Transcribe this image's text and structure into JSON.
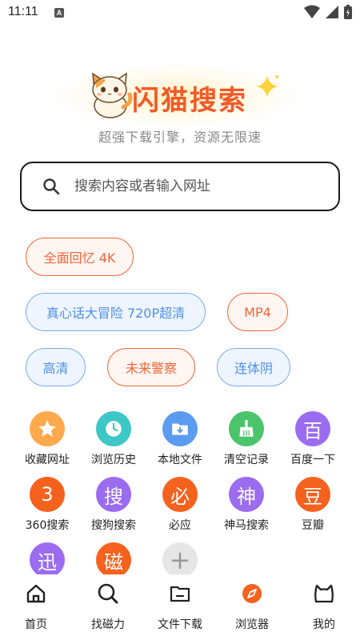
{
  "status": {
    "time": "11:11",
    "notif_letter": "A"
  },
  "hero": {
    "brand": "闪猫搜索",
    "slogan": "超强下载引擎，资源无限速"
  },
  "search": {
    "placeholder": "搜索内容或者输入网址"
  },
  "tags": [
    {
      "label": "全面回忆 4K",
      "style": "orange"
    },
    {
      "label": "真心话大冒险 720P超清",
      "style": "blue"
    },
    {
      "label": "MP4",
      "style": "orange"
    },
    {
      "label": "高清",
      "style": "blue"
    },
    {
      "label": "未来警察",
      "style": "orange"
    },
    {
      "label": "连体阴",
      "style": "blue"
    }
  ],
  "shortcuts": [
    {
      "label": "收藏网址",
      "icon": "star-icon",
      "glyph": "★",
      "color": "#ffa94d"
    },
    {
      "label": "浏览历史",
      "icon": "clock-icon",
      "glyph": "",
      "color": "#3dc7c6"
    },
    {
      "label": "本地文件",
      "icon": "folder-download-icon",
      "glyph": "",
      "color": "#5b9cf0"
    },
    {
      "label": "清空记录",
      "icon": "broom-icon",
      "glyph": "",
      "color": "#4cc46b"
    },
    {
      "label": "百度一下",
      "icon": "baidu-icon",
      "glyph": "百",
      "color": "#9b6cf0"
    },
    {
      "label": "360搜索",
      "icon": "360-icon",
      "glyph": "3",
      "color": "#f5621e"
    },
    {
      "label": "搜狗搜索",
      "icon": "sogou-icon",
      "glyph": "搜",
      "color": "#9b6cf0"
    },
    {
      "label": "必应",
      "icon": "bing-icon",
      "glyph": "必",
      "color": "#f5621e"
    },
    {
      "label": "神马搜索",
      "icon": "shenma-icon",
      "glyph": "神",
      "color": "#9b6cf0"
    },
    {
      "label": "豆瓣",
      "icon": "douban-icon",
      "glyph": "豆",
      "color": "#f5621e"
    },
    {
      "label": "",
      "icon": "xun-icon",
      "glyph": "迅",
      "color": "#9b6cf0"
    },
    {
      "label": "",
      "icon": "ci-icon",
      "glyph": "磁",
      "color": "#f5621e"
    },
    {
      "label": "",
      "icon": "add-icon",
      "glyph": "+",
      "color": "#e6e6e6"
    }
  ],
  "nav": [
    {
      "label": "首页",
      "icon": "home-icon"
    },
    {
      "label": "找磁力",
      "icon": "magnet-search-icon"
    },
    {
      "label": "文件下载",
      "icon": "folder-icon"
    },
    {
      "label": "浏览器",
      "icon": "browser-compass-icon"
    },
    {
      "label": "我的",
      "icon": "cat-profile-icon"
    }
  ],
  "colors": {
    "brand": "#f05a28",
    "accent_orange": "#f0663a",
    "accent_blue": "#4f8fe6"
  }
}
